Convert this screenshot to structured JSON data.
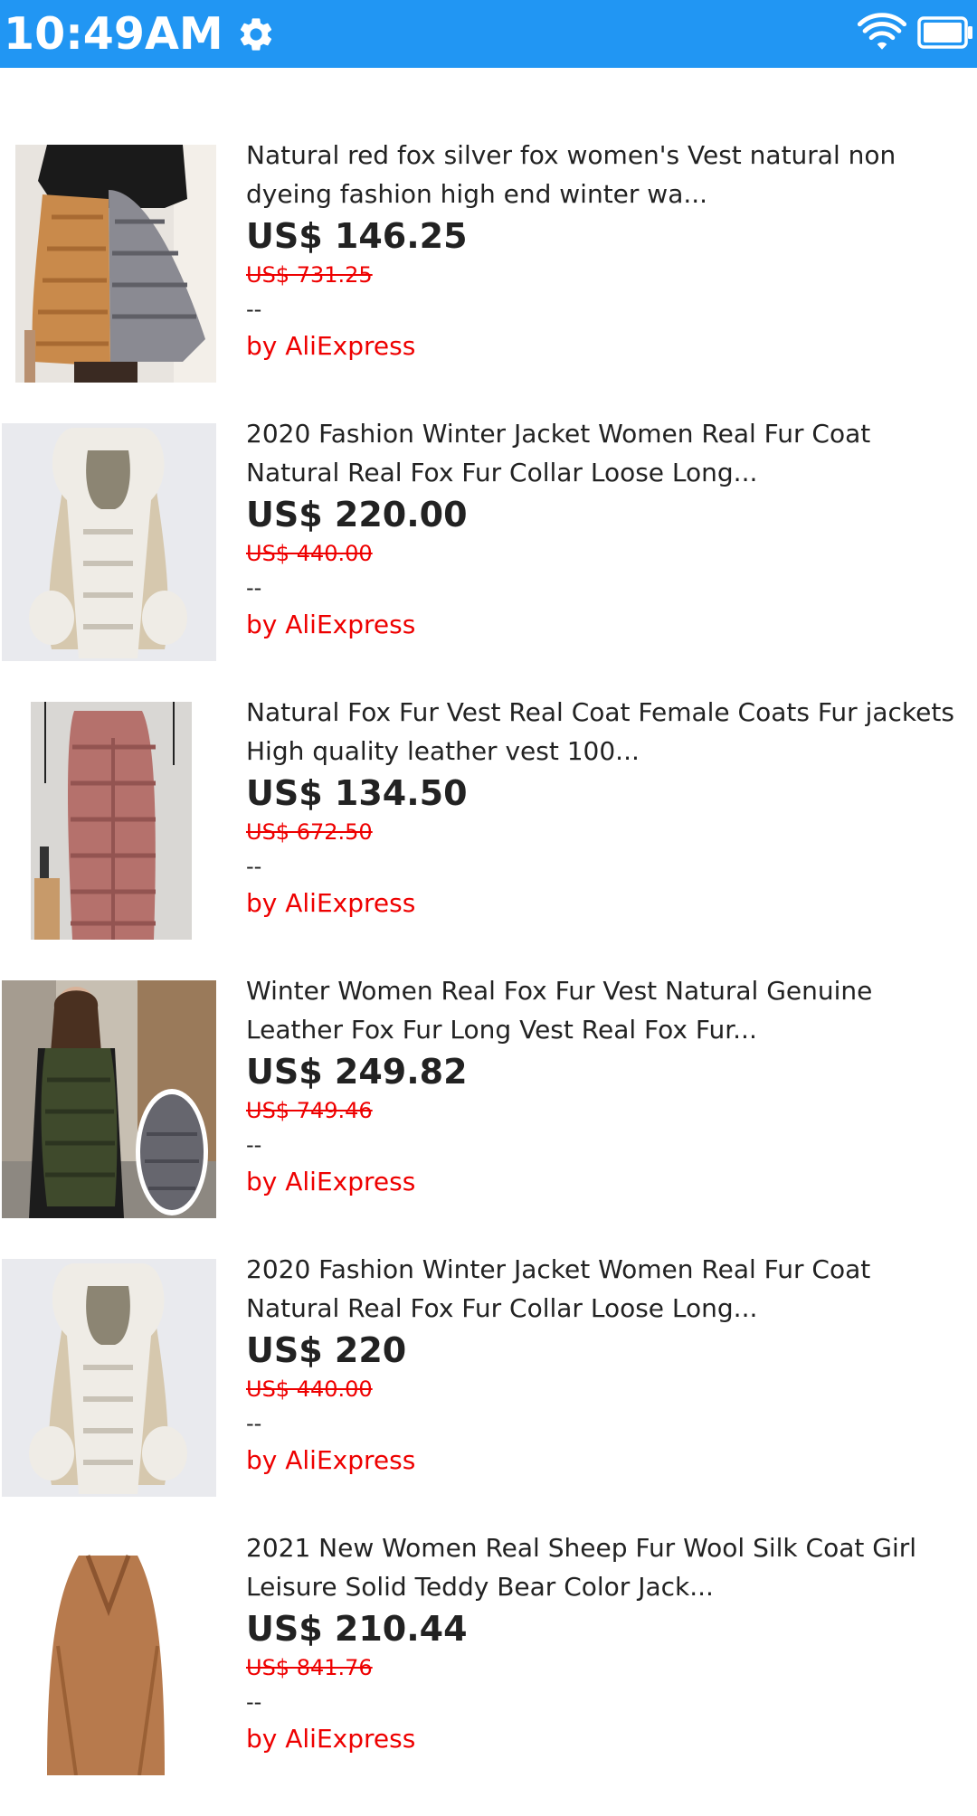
{
  "status_bar": {
    "time": "10:49AM",
    "bg_color": "#2196f3",
    "icons": [
      "gear-icon",
      "wifi-icon",
      "battery-icon"
    ]
  },
  "products": [
    {
      "title": "Natural red fox silver fox women's Vest natural non dyeing fashion high end winter wa...",
      "price": "US$ 146.25",
      "old_price": "US$ 731.25",
      "rating": "--",
      "seller": "by AliExpress",
      "image": "fox-vest-orange-grey"
    },
    {
      "title": "2020 Fashion Winter Jacket Women Real Fur Coat Natural Real Fox Fur Collar Loose Long...",
      "price": "US$ 220.00",
      "old_price": "US$ 440.00",
      "rating": "--",
      "seller": "by AliExpress",
      "image": "beige-parka-fur-hood"
    },
    {
      "title": "Natural Fox Fur Vest Real Coat Female Coats Fur jackets High quality leather vest 100...",
      "price": "US$ 134.50",
      "old_price": "US$ 672.50",
      "rating": "--",
      "seller": "by AliExpress",
      "image": "pink-fur-vest"
    },
    {
      "title": "Winter Women Real Fox Fur Vest Natural Genuine Leather Fox Fur Long Vest Real Fox Fur...",
      "price": "US$ 249.82",
      "old_price": "US$ 749.46",
      "rating": "--",
      "seller": "by AliExpress",
      "image": "green-fur-vest-woman"
    },
    {
      "title": "2020 Fashion Winter Jacket Women Real Fur Coat Natural Real Fox Fur Collar Loose Long...",
      "price": "US$ 220",
      "old_price": "US$ 440.00",
      "rating": "--",
      "seller": "by AliExpress",
      "image": "beige-parka-fur-hood"
    },
    {
      "title": "2021 New Women Real Sheep Fur Wool Silk Coat Girl Leisure Solid Teddy Bear Color Jack...",
      "price": "US$ 210.44",
      "old_price": "US$ 841.76",
      "rating": "--",
      "seller": "by AliExpress",
      "image": "brown-teddy-coat"
    }
  ]
}
